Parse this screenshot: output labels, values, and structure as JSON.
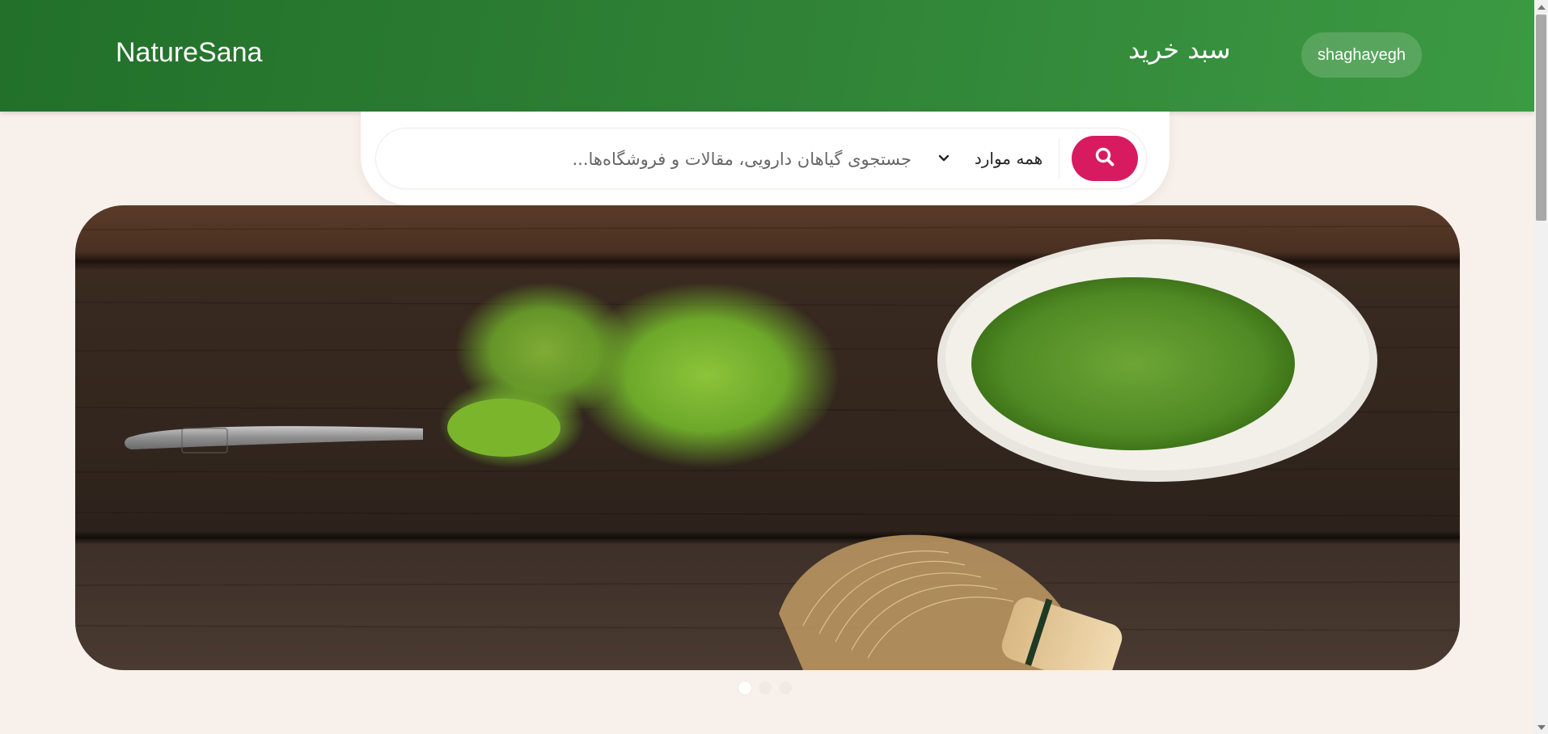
{
  "header": {
    "brand": "NatureSana",
    "cart_label": "سبد خرید",
    "user_label": "shaghayegh"
  },
  "search": {
    "placeholder": "جستجوی گیاهان دارویی، مقالات و فروشگاه‌ها...",
    "value": "",
    "category_selected": "همه موارد"
  },
  "carousel": {
    "slide_count": 3,
    "active_index": 0
  },
  "icons": {
    "search": "search-icon",
    "chevron": "chevron-down-icon"
  },
  "colors": {
    "header_green": "#2f8236",
    "search_button": "#d81b60",
    "page_background": "#f8f0eb"
  }
}
